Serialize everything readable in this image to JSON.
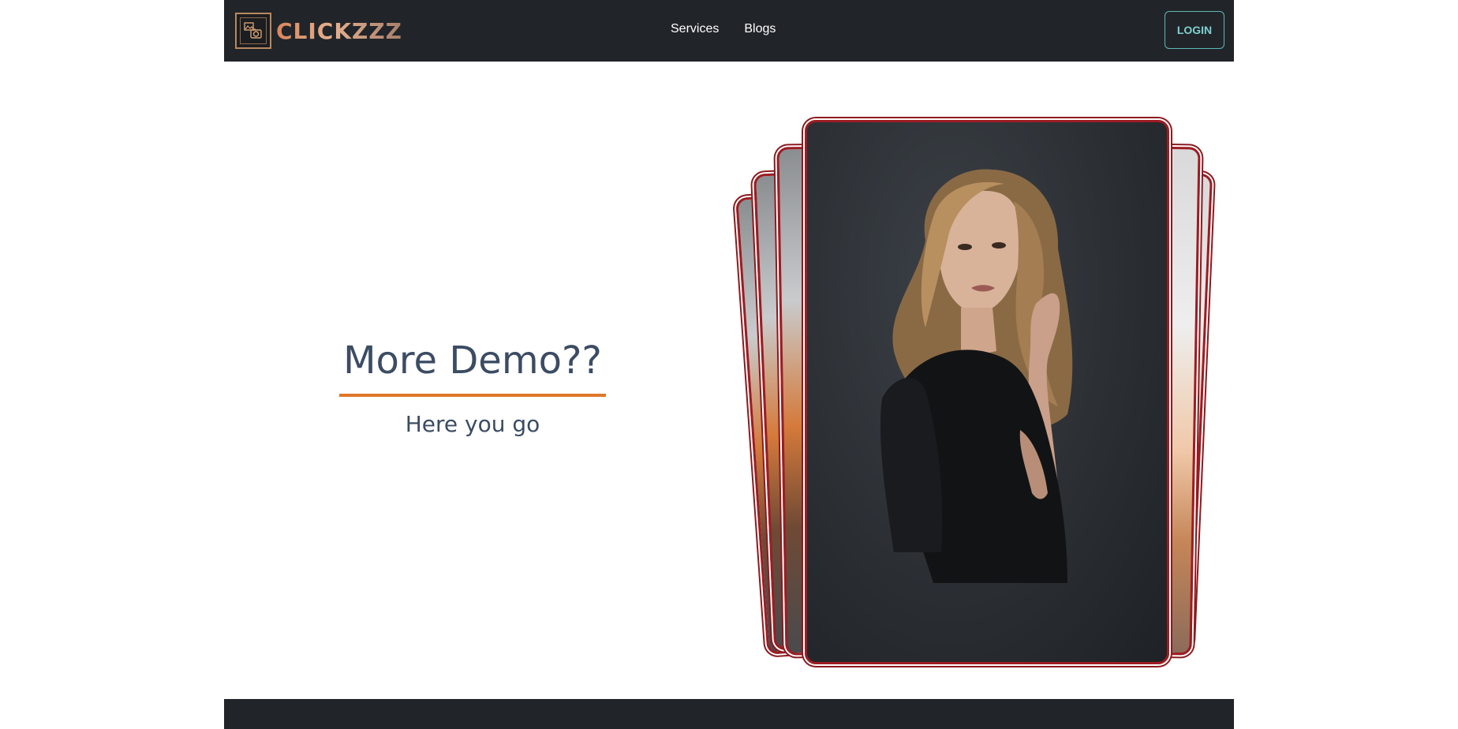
{
  "brand": {
    "name": "CLICKZZZ",
    "logo_icon": "camera-photo-frame-icon"
  },
  "nav": {
    "links": [
      {
        "label": "Services"
      },
      {
        "label": "Blogs"
      }
    ],
    "login_label": "LOGIN"
  },
  "hero": {
    "title": "More Demo??",
    "subtitle": "Here you go",
    "accent_color": "#e0782c",
    "text_color": "#3b4c63"
  },
  "gallery": {
    "card_border_color": "#9d1c22",
    "main_image_icon": "portrait-photo-image"
  },
  "colors": {
    "navbar_bg": "#212529",
    "login_border": "#5fb7b7"
  }
}
